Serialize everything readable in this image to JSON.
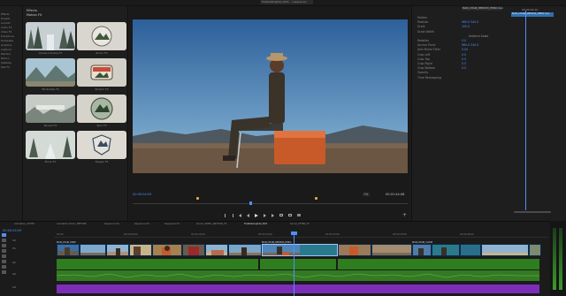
{
  "topbar": {
    "sequence_chip": "Trailblazingtrail_Edit... / sequence"
  },
  "effects_panel": {
    "sidebar_items": [
      "Effects",
      "Presets",
      "Lumetri",
      "Audio FX",
      "Video FX",
      "Transitions",
      "Templates",
      "Graphics",
      "Captions",
      "Markers",
      "Motion",
      "Stabilize",
      "Text FX"
    ],
    "breadcrumb": "Effects",
    "folder": "Motion FX",
    "thumbnails": [
      {
        "label": "Camera Shake FX"
      },
      {
        "label": "Zoom FX"
      },
      {
        "label": "3D Rotate FX"
      },
      {
        "label": "Stretch FX"
      },
      {
        "label": "Reveal FX"
      },
      {
        "label": "Spin FX"
      },
      {
        "label": "Move FX"
      },
      {
        "label": "Wiggle FX"
      }
    ]
  },
  "monitor": {
    "timecode_left": "00:00:04:09",
    "timecode_right": "00:01:44:08",
    "fit_label": "Fit"
  },
  "effect_controls": {
    "clip_tab": "MAN_CHAIR_MEDIUM_HERO.mov",
    "clip_bar": "MAN_CHAIR_MEDIUM_HERO.mov",
    "timecode": "00:00:04:10",
    "rows": [
      {
        "label": "Motion",
        "value": ""
      },
      {
        "label": "Position",
        "value": "960.0  540.0"
      },
      {
        "label": "Scale",
        "value": "100.0"
      },
      {
        "label": "Scale Width",
        "value": ""
      },
      {
        "label": "",
        "value": "Uniform Scale"
      },
      {
        "label": "Rotation",
        "value": "0.0"
      },
      {
        "label": "Anchor Point",
        "value": "960.0  540.0"
      },
      {
        "label": "Anti-flicker Filter",
        "value": "0.00"
      },
      {
        "label": "Crop Left",
        "value": "0.0"
      },
      {
        "label": "Crop Top",
        "value": "0.0"
      },
      {
        "label": "Crop Right",
        "value": "0.0"
      },
      {
        "label": "Crop Bottom",
        "value": "0.0"
      },
      {
        "label": "Opacity",
        "value": ""
      },
      {
        "label": "Time Remapping",
        "value": ""
      }
    ]
  },
  "timeline": {
    "timecode": "00:00:04:09",
    "tabs": [
      "Animation_AFTER",
      "Animation Demo_BEFORE",
      "Sequence 01",
      "Sequence 02",
      "Sequence 03",
      "Social_VIDEO_ANCHOR_FX",
      "Trailblazingtrail_Edit",
      "Social_AFTER_FX"
    ],
    "ruler": [
      "00:00",
      "00:00:08:00",
      "00:00:16:00",
      "00:00:24:00",
      "00:00:32:00",
      "00:00:40:00",
      "00:00:48:00"
    ],
    "tracks": [
      "V2",
      "V1",
      "A1",
      "A2",
      "A3"
    ],
    "clip_labels": [
      "MAN_CHAIR_WIDE",
      "MAN_CHAIR_MEDIUM_HERO",
      "MAN_CHAIR_CLOSE"
    ]
  },
  "colors": {
    "accent": "#4f8ff7",
    "video_clip": "#2f6fb0",
    "audio_clip": "#2e7d1e",
    "audio_clip_2": "#7b2fb8",
    "playhead": "#4f8ff7",
    "keyframe": "#e8a74a"
  }
}
